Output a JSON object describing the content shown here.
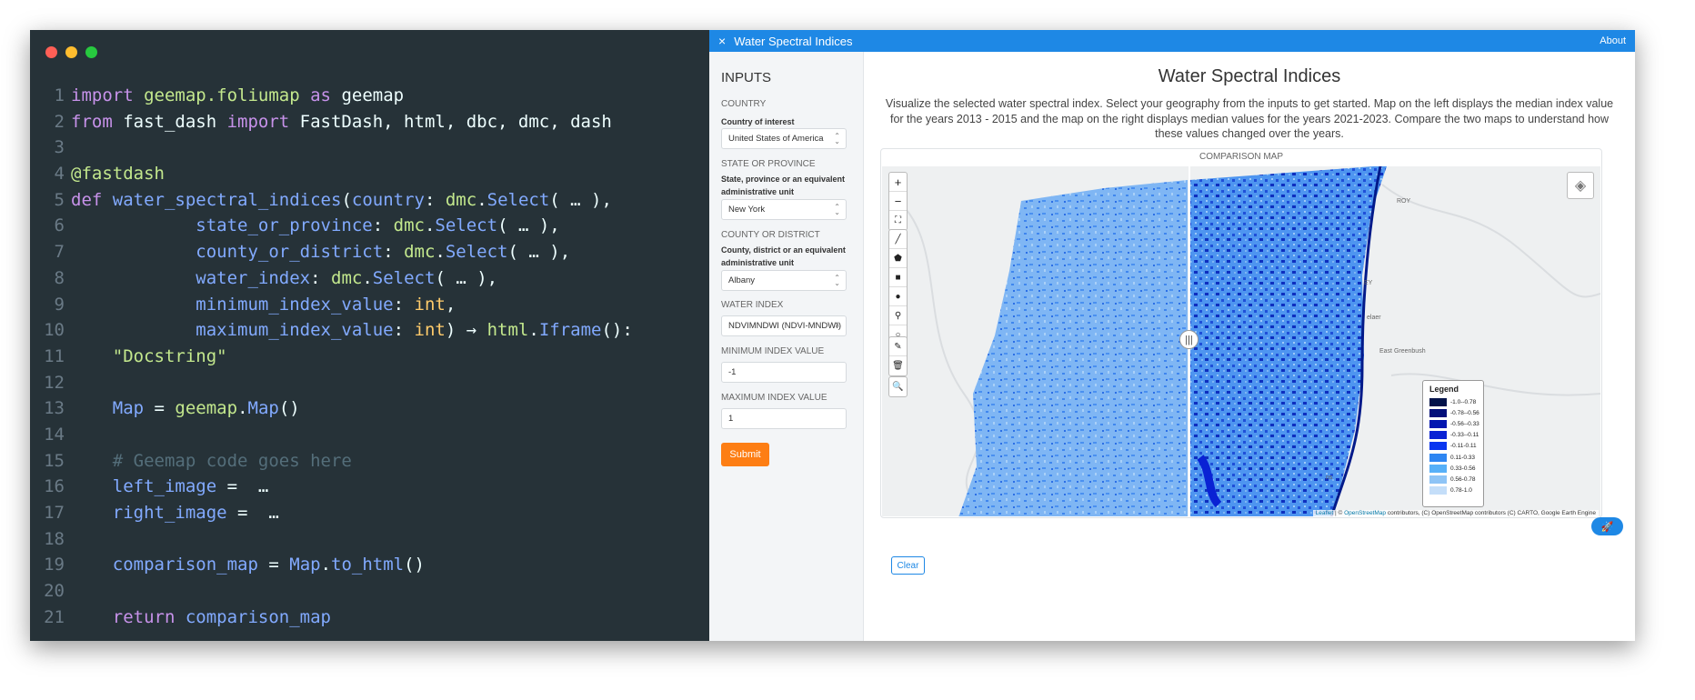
{
  "code_lines": [
    {
      "n": "1",
      "tokens": [
        [
          "kw",
          "import "
        ],
        [
          "mod",
          "geemap.foliumap"
        ],
        [
          "kw",
          " as "
        ],
        [
          "plain",
          "geemap"
        ]
      ]
    },
    {
      "n": "2",
      "tokens": [
        [
          "kw",
          "from "
        ],
        [
          "plain",
          "fast_dash "
        ],
        [
          "kw",
          "import "
        ],
        [
          "plain",
          "FastDash, html, dbc, dmc, dash"
        ]
      ]
    },
    {
      "n": "3",
      "tokens": []
    },
    {
      "n": "4",
      "tokens": [
        [
          "dec",
          "@fastdash"
        ]
      ]
    },
    {
      "n": "5",
      "tokens": [
        [
          "kw",
          "def "
        ],
        [
          "fn",
          "water_spectral_indices"
        ],
        [
          "plain",
          "("
        ],
        [
          "fn",
          "country"
        ],
        [
          "plain",
          ": "
        ],
        [
          "mod",
          "dmc"
        ],
        [
          "plain",
          "."
        ],
        [
          "cls",
          "Select"
        ],
        [
          "plain",
          "( … ),"
        ]
      ]
    },
    {
      "n": "6",
      "tokens": [
        [
          "plain",
          "            "
        ],
        [
          "fn",
          "state_or_province"
        ],
        [
          "plain",
          ": "
        ],
        [
          "mod",
          "dmc"
        ],
        [
          "plain",
          "."
        ],
        [
          "cls",
          "Select"
        ],
        [
          "plain",
          "( … ),"
        ]
      ]
    },
    {
      "n": "7",
      "tokens": [
        [
          "plain",
          "            "
        ],
        [
          "fn",
          "county_or_district"
        ],
        [
          "plain",
          ": "
        ],
        [
          "mod",
          "dmc"
        ],
        [
          "plain",
          "."
        ],
        [
          "cls",
          "Select"
        ],
        [
          "plain",
          "( … ),"
        ]
      ]
    },
    {
      "n": "8",
      "tokens": [
        [
          "plain",
          "            "
        ],
        [
          "fn",
          "water_index"
        ],
        [
          "plain",
          ": "
        ],
        [
          "mod",
          "dmc"
        ],
        [
          "plain",
          "."
        ],
        [
          "cls",
          "Select"
        ],
        [
          "plain",
          "( … ),"
        ]
      ]
    },
    {
      "n": "9",
      "tokens": [
        [
          "plain",
          "            "
        ],
        [
          "fn",
          "minimum_index_value"
        ],
        [
          "plain",
          ": "
        ],
        [
          "ty",
          "int"
        ],
        [
          "plain",
          ","
        ]
      ]
    },
    {
      "n": "10",
      "tokens": [
        [
          "plain",
          "            "
        ],
        [
          "fn",
          "maximum_index_value"
        ],
        [
          "plain",
          ": "
        ],
        [
          "ty",
          "int"
        ],
        [
          "plain",
          ") → "
        ],
        [
          "mod",
          "html"
        ],
        [
          "plain",
          "."
        ],
        [
          "cls",
          "Iframe"
        ],
        [
          "plain",
          "():"
        ]
      ]
    },
    {
      "n": "11",
      "tokens": [
        [
          "plain",
          "    "
        ],
        [
          "str",
          "\"Docstring\""
        ]
      ]
    },
    {
      "n": "12",
      "tokens": []
    },
    {
      "n": "13",
      "tokens": [
        [
          "plain",
          "    "
        ],
        [
          "fn",
          "Map"
        ],
        [
          "plain",
          " = "
        ],
        [
          "mod",
          "geemap"
        ],
        [
          "plain",
          "."
        ],
        [
          "cls",
          "Map"
        ],
        [
          "plain",
          "()"
        ]
      ]
    },
    {
      "n": "14",
      "tokens": []
    },
    {
      "n": "15",
      "tokens": [
        [
          "plain",
          "    "
        ],
        [
          "cmt",
          "# Geemap code goes here"
        ]
      ]
    },
    {
      "n": "16",
      "tokens": [
        [
          "plain",
          "    "
        ],
        [
          "fn",
          "left_image"
        ],
        [
          "plain",
          " =  …"
        ]
      ]
    },
    {
      "n": "17",
      "tokens": [
        [
          "plain",
          "    "
        ],
        [
          "fn",
          "right_image"
        ],
        [
          "plain",
          " =  …"
        ]
      ]
    },
    {
      "n": "18",
      "tokens": []
    },
    {
      "n": "19",
      "tokens": [
        [
          "plain",
          "    "
        ],
        [
          "fn",
          "comparison_map"
        ],
        [
          "plain",
          " = "
        ],
        [
          "fn",
          "Map"
        ],
        [
          "plain",
          "."
        ],
        [
          "cls",
          "to_html"
        ],
        [
          "plain",
          "()"
        ]
      ]
    },
    {
      "n": "20",
      "tokens": []
    },
    {
      "n": "21",
      "tokens": [
        [
          "plain",
          "    "
        ],
        [
          "kw",
          "return "
        ],
        [
          "fn",
          "comparison_map"
        ]
      ]
    }
  ],
  "app": {
    "title": "Water Spectral Indices",
    "close_icon": "×",
    "about": "About"
  },
  "sidebar": {
    "title": "INPUTS",
    "country": {
      "label": "COUNTRY",
      "desc": "Country of interest",
      "value": "United States of America"
    },
    "state": {
      "label": "STATE OR PROVINCE",
      "desc": "State, province or an equivalent administrative unit",
      "value": "New York"
    },
    "county": {
      "label": "COUNTY OR DISTRICT",
      "desc": "County, district or an equivalent administrative unit",
      "value": "Albany"
    },
    "water_index": {
      "label": "WATER INDEX",
      "value": "NDVIMNDWI (NDVI-MNDWI)"
    },
    "min_index": {
      "label": "MINIMUM INDEX VALUE",
      "value": "-1"
    },
    "max_index": {
      "label": "MAXIMUM INDEX VALUE",
      "value": "1"
    },
    "submit": "Submit"
  },
  "main": {
    "title": "Water Spectral Indices",
    "description": "Visualize the selected water spectral index. Select your geography from the inputs to get started. Map on the left displays the median index value for the years 2013 - 2015 and the map on the right displays median values for the years 2021-2023. Compare the two maps to understand how these values changed over the years.",
    "card_title": "COMPARISON MAP",
    "clear": "Clear",
    "map_labels": {
      "east_greenbush": "East Greenbush",
      "roy": "ROY",
      "ey": "EY",
      "elaer": "elaer",
      "ns": "ns"
    },
    "attribution": {
      "leaflet": "Leaflet",
      "sep": " | © ",
      "osm": "OpenStreetMap",
      "rest": " contributors, (C) OpenStreetMap contributors (C) CARTO, Google Earth Engine"
    },
    "controls": {
      "zoom_in": "+",
      "zoom_out": "−"
    }
  },
  "legend": {
    "title": "Legend",
    "items": [
      {
        "label": "-1.0--0.78",
        "color": "#03134a"
      },
      {
        "label": "-0.78--0.56",
        "color": "#020f7a"
      },
      {
        "label": "-0.56--0.33",
        "color": "#0316b0"
      },
      {
        "label": "-0.33--0.11",
        "color": "#0a22d4"
      },
      {
        "label": "-0.11-0.11",
        "color": "#0a36f0"
      },
      {
        "label": "0.11-0.33",
        "color": "#2f86f2"
      },
      {
        "label": "0.33-0.56",
        "color": "#57b0f8"
      },
      {
        "label": "0.56-0.78",
        "color": "#8ec4f6"
      },
      {
        "label": "0.78-1.0",
        "color": "#c4def9"
      }
    ]
  },
  "colors": {
    "accent": "#1e88e5",
    "submit": "#fd7e14",
    "editor_bg": "#263238"
  }
}
